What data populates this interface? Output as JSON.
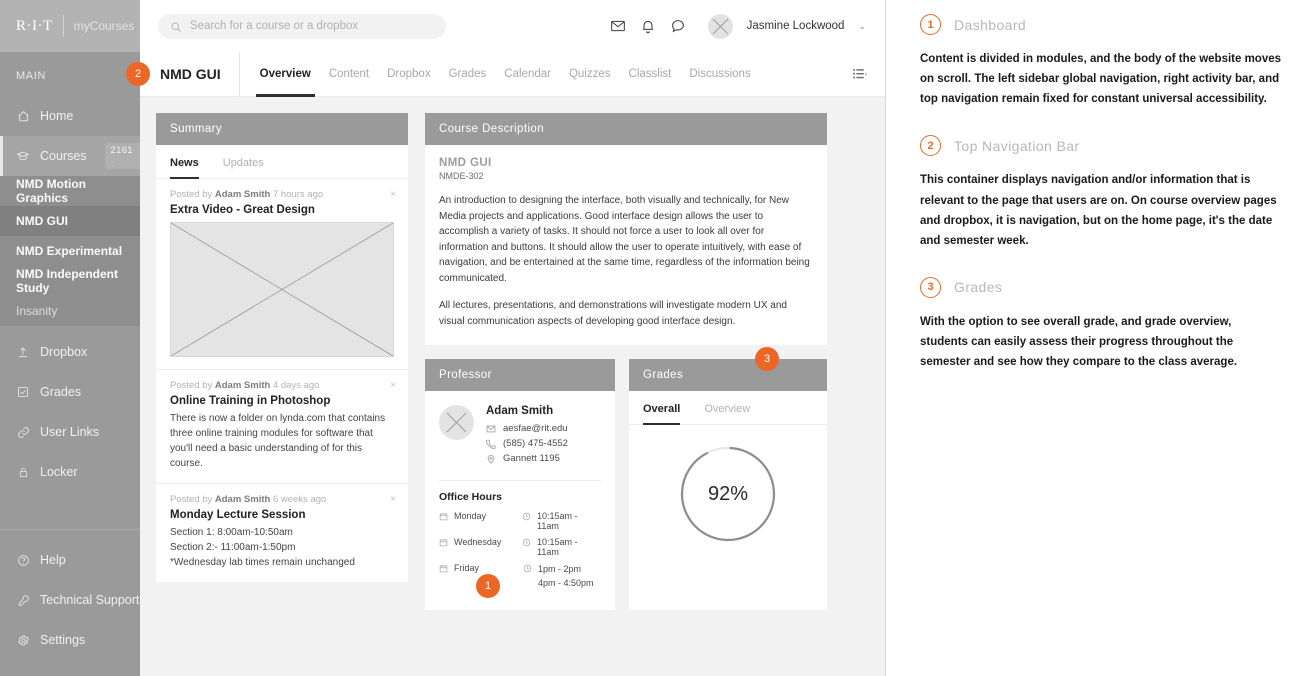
{
  "brand": {
    "logo": "R·I·T",
    "product": "myCourses"
  },
  "search": {
    "placeholder": "Search for a course or a dropbox",
    "icon": "search-icon"
  },
  "topbar": {
    "icons": [
      "mail-icon",
      "bell-icon",
      "chat-icon"
    ],
    "user_name": "Jasmine Lockwood",
    "caret": "⌄"
  },
  "sidebar": {
    "section_label": "MAIN",
    "items": [
      {
        "label": "Home",
        "icon": "home-icon"
      },
      {
        "label": "Courses",
        "icon": "courses-icon",
        "badge": "2161 ·"
      }
    ],
    "courses": [
      {
        "label": "NMD Motion Graphics",
        "selected": false,
        "dim": false
      },
      {
        "label": "NMD GUI",
        "selected": true,
        "dim": false
      },
      {
        "label": "NMD Experimental",
        "selected": false,
        "dim": false
      },
      {
        "label": "NMD Independent Study",
        "selected": false,
        "dim": false
      },
      {
        "label": "Insanity",
        "selected": false,
        "dim": true
      }
    ],
    "lower": [
      {
        "label": "Dropbox",
        "icon": "upload-icon"
      },
      {
        "label": "Grades",
        "icon": "checkbox-icon"
      },
      {
        "label": "User Links",
        "icon": "link-icon"
      },
      {
        "label": "Locker",
        "icon": "lock-icon"
      }
    ],
    "bottom": [
      {
        "label": "Help",
        "icon": "question-icon"
      },
      {
        "label": "Technical Support",
        "icon": "wrench-icon"
      },
      {
        "label": "Settings",
        "icon": "gear-icon"
      }
    ]
  },
  "coursebar": {
    "title": "NMD GUI",
    "tabs": [
      {
        "label": "Overview",
        "active": true
      },
      {
        "label": "Content",
        "active": false
      },
      {
        "label": "Dropbox",
        "active": false
      },
      {
        "label": "Grades",
        "active": false
      },
      {
        "label": "Calendar",
        "active": false
      },
      {
        "label": "Quizzes",
        "active": false
      },
      {
        "label": "Classlist",
        "active": false
      },
      {
        "label": "Discussions",
        "active": false
      }
    ],
    "right_icon": "activity-list-icon"
  },
  "summary": {
    "header": "Summary",
    "tabs": [
      {
        "label": "News",
        "active": true
      },
      {
        "label": "Updates",
        "active": false
      }
    ],
    "posts": [
      {
        "meta_prefix": "Posted by ",
        "author": "Adam Smith",
        "meta_suffix": " 7 hours ago",
        "title": "Extra Video - Great Design",
        "body": "",
        "has_image": true,
        "close": "×"
      },
      {
        "meta_prefix": "Posted by ",
        "author": "Adam Smith",
        "meta_suffix": " 4 days ago",
        "title": "Online Training in Photoshop",
        "body": "There is now a folder on lynda.com that contains three online training modules for software that you'll need a basic understanding of for this course.",
        "has_image": false,
        "close": "×"
      },
      {
        "meta_prefix": "Posted by ",
        "author": "Adam Smith",
        "meta_suffix": " 6 weeks ago",
        "title": "Monday Lecture Session",
        "body": "Section 1: 8:00am-10:50am\nSection 2:- 11:00am-1:50pm\n*Wednesday lab times remain unchanged",
        "has_image": false,
        "close": "×"
      }
    ]
  },
  "description": {
    "header": "Course Description",
    "course_name": "NMD GUI",
    "course_code": "NMDE-302",
    "paragraphs": [
      "An introduction to designing the interface, both visually and technically, for New Media projects and applications. Good interface design allows the user to accomplish a variety of tasks. It should not force a user to look all over for information and buttons. It should allow the user to operate intuitively, with ease of navigation, and be entertained at the same time, regardless of the information being communicated.",
      "All lectures, presentations, and demonstrations will investigate modern UX and visual communication aspects of developing good interface design."
    ]
  },
  "professor": {
    "header": "Professor",
    "name": "Adam Smith",
    "email": "aesfae@rit.edu",
    "phone": "(585) 475-4552",
    "location": "Gannett 1195",
    "office_hours_title": "Office Hours",
    "office_hours": [
      {
        "day": "Monday",
        "time": "10:15am - 11am"
      },
      {
        "day": "Wednesday",
        "time": "10:15am - 11am"
      },
      {
        "day": "Friday",
        "time": "1pm - 2pm\n4pm - 4:50pm"
      }
    ]
  },
  "grades": {
    "header": "Grades",
    "tabs": [
      {
        "label": "Overall",
        "active": true
      },
      {
        "label": "Overview",
        "active": false
      }
    ],
    "value_label": "92%",
    "percent": 92
  },
  "markers": {
    "one": "1",
    "two": "2",
    "three": "3"
  },
  "notes": [
    {
      "num": "1",
      "title": "Dashboard",
      "body": "Content is divided in modules, and the body of the website moves on scroll. The left sidebar global navigation, right activity bar, and top navigation remain fixed for constant universal accessibility."
    },
    {
      "num": "2",
      "title": "Top Navigation Bar",
      "body": "This container displays navigation and/or information that is relevant to the page that users are on. On course overview pages and dropbox, it is navigation, but on the home page, it's the date and semester week."
    },
    {
      "num": "3",
      "title": "Grades",
      "body": "With the option to see overall grade, and grade overview, students can easily assess their progress throughout the semester and see how they compare to the class average."
    }
  ],
  "colors": {
    "accent": "#ec6726",
    "sidebar": "#9a9a9a",
    "card_header": "#9a9a9a"
  }
}
